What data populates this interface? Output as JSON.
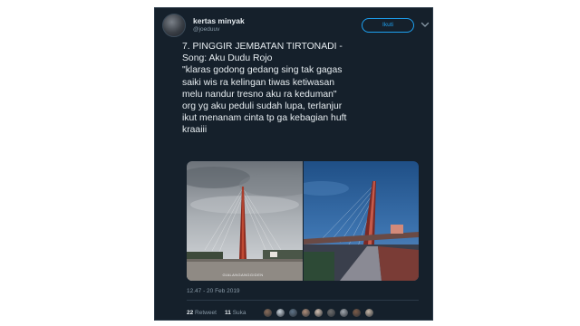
{
  "user": {
    "name": "kertas minyak",
    "handle": "@joeduuv",
    "follow_label": "Ikuti"
  },
  "tweet": {
    "lines": [
      "7. PINGGIR JEMBATAN TIRTONADI -",
      "Song: Aku Dudu Rojo",
      "\"klaras godong gedang sing tak gagas",
      "saiki wis ra kelingan tiwas ketiwasan",
      "melu nandur tresno aku ra keduman\"",
      "org yg aku peduli sudah lupa, terlanjur",
      "ikut menanam cinta tp ga kebagian huft",
      "kraaiii"
    ],
    "photo_watermark": "GIALANGANGGIDEN",
    "timestamp": "12.47 - 20 Feb 2019",
    "retweet_count": "22",
    "retweet_label": "Retweet",
    "like_count": "11",
    "like_label": "Suka"
  },
  "colors": {
    "background": "#15202b",
    "accent": "#1da1f2",
    "text_primary": "#e6ecf0",
    "text_secondary": "#8899a6"
  },
  "icons": [
    "chevron-down-icon"
  ],
  "liker_avatar_colors": [
    "#8a6d5a",
    "#c9d3dc",
    "#5f7488",
    "#b08f7a",
    "#d4c2b3",
    "#6e6e6e",
    "#a3a9b0",
    "#7d5c48",
    "#c7b8a8"
  ]
}
